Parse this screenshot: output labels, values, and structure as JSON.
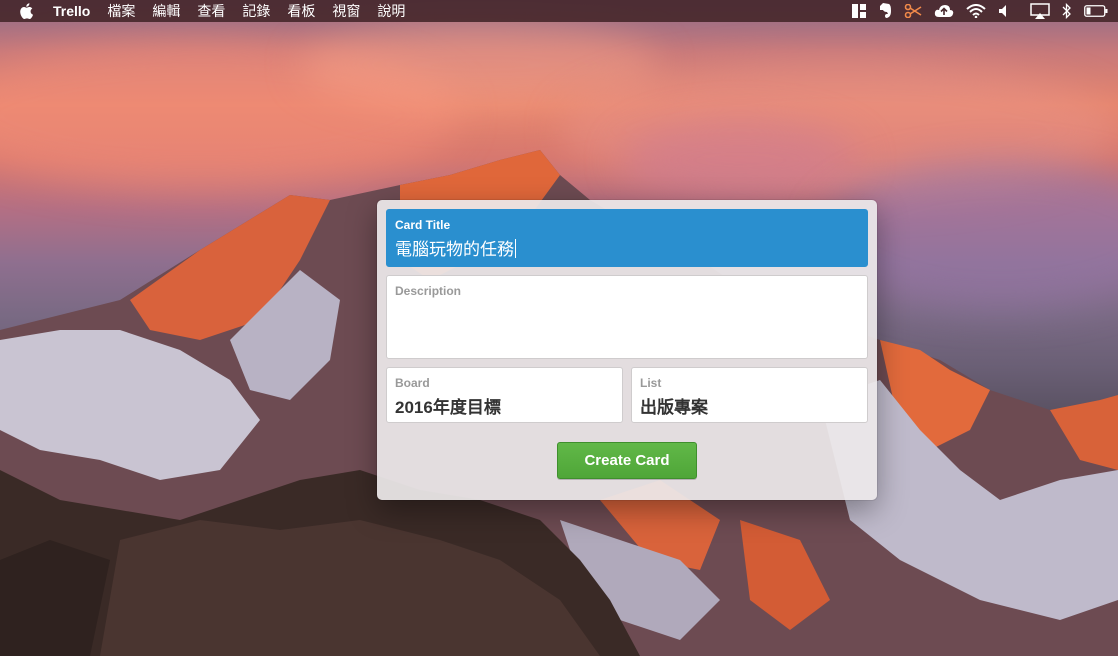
{
  "menubar": {
    "apple_icon": "apple-logo-icon",
    "app_name": "Trello",
    "menus": [
      "檔案",
      "編輯",
      "查看",
      "記錄",
      "看板",
      "視窗",
      "說明"
    ],
    "status_icons": [
      "grid-icon",
      "evernote-icon",
      "scissors-icon",
      "cloud-upload-icon",
      "wifi-icon",
      "volume-icon",
      "airplay-icon",
      "bluetooth-icon",
      "battery-icon"
    ]
  },
  "card_form": {
    "title": {
      "label": "Card Title",
      "value": "電腦玩物的任務"
    },
    "description": {
      "label": "Description",
      "value": ""
    },
    "board": {
      "label": "Board",
      "value": "2016年度目標"
    },
    "list": {
      "label": "List",
      "value": "出版專案"
    },
    "create_button": "Create Card"
  },
  "colors": {
    "active_field": "#2a8fcf",
    "create_button": "#5ab143",
    "menubar": "#48282c"
  }
}
